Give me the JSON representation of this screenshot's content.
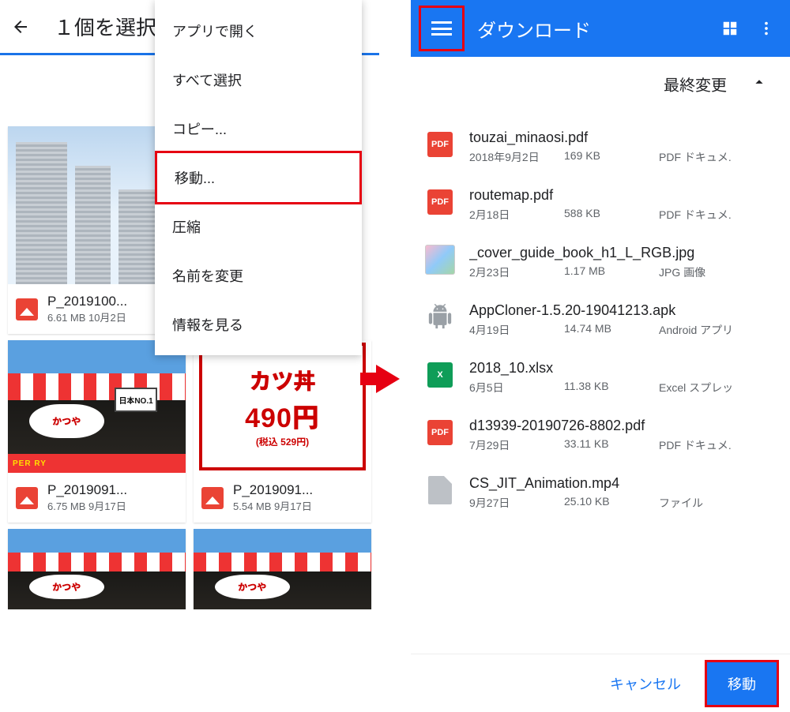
{
  "left": {
    "title": "１個を選択",
    "menu": {
      "open_with": "アプリで開く",
      "select_all": "すべて選択",
      "copy": "コピー...",
      "move": "移動...",
      "compress": "圧縮",
      "rename": "名前を変更",
      "info": "情報を見る"
    },
    "grid": [
      {
        "name": "P_2019100...",
        "size": "6.61 MB",
        "date": "10月2日"
      },
      {
        "name": "P_2019091...",
        "size": "6.75 MB",
        "date": "9月17日"
      },
      {
        "name": "P_2019091...",
        "size": "5.54 MB",
        "date": "9月17日"
      }
    ],
    "sign": {
      "line1": "カツ丼",
      "line2": "490円",
      "line3": "(税込 529円)"
    }
  },
  "right": {
    "title": "ダウンロード",
    "sort_label": "最終変更",
    "files": [
      {
        "icon": "pdf",
        "name": "touzai_minaosi.pdf",
        "date": "2018年9月2日",
        "size": "169 KB",
        "type": "PDF ドキュメ."
      },
      {
        "icon": "pdf",
        "name": "routemap.pdf",
        "date": "2月18日",
        "size": "588 KB",
        "type": "PDF ドキュメ."
      },
      {
        "icon": "img",
        "name": "_cover_guide_book_h1_L_RGB.jpg",
        "date": "2月23日",
        "size": "1.17 MB",
        "type": "JPG 画像"
      },
      {
        "icon": "apk",
        "name": "AppCloner-1.5.20-19041213.apk",
        "date": "4月19日",
        "size": "14.74 MB",
        "type": "Android アプリ"
      },
      {
        "icon": "xlsx",
        "name": "2018_10.xlsx",
        "date": "6月5日",
        "size": "11.38 KB",
        "type": "Excel スプレッ"
      },
      {
        "icon": "pdf",
        "name": "d13939-20190726-8802.pdf",
        "date": "7月29日",
        "size": "33.11 KB",
        "type": "PDF ドキュメ."
      },
      {
        "icon": "gen",
        "name": "CS_JIT_Animation.mp4",
        "date": "9月27日",
        "size": "25.10 KB",
        "type": "ファイル"
      }
    ],
    "cancel": "キャンセル",
    "move": "移動"
  },
  "icon_labels": {
    "pdf": "PDF",
    "xlsx": "X"
  }
}
